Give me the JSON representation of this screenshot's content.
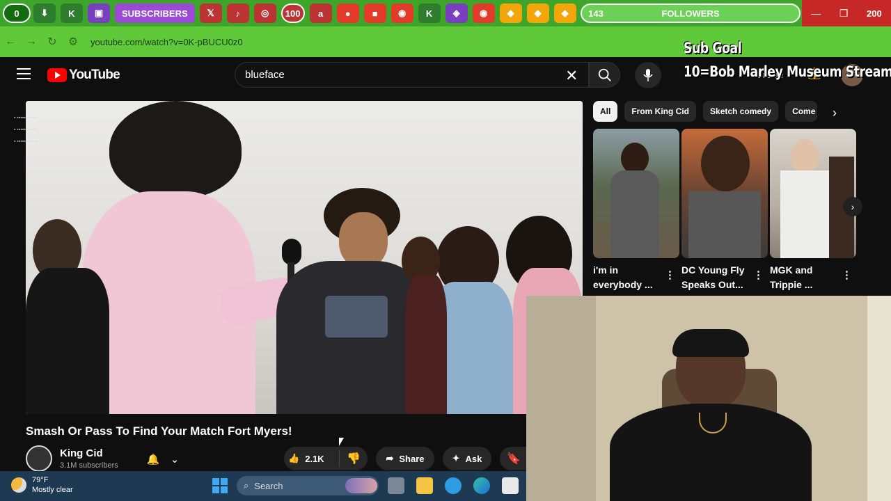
{
  "stream_bar": {
    "left_count": "0",
    "subscribers_label": "SUBSCRIBERS",
    "badge_100": "100",
    "followers_count": "143",
    "followers_label": "FOLLOWERS",
    "right_count": "200"
  },
  "browser": {
    "url": "youtube.com/watch?v=0K-pBUCU0z0"
  },
  "stream_overlay": {
    "sub_goal": "Sub Goal",
    "goal_text": "10=Bob Marley Museum Stream"
  },
  "youtube": {
    "logo_text": "YouTube",
    "search_query": "blueface",
    "create_label": "Create",
    "video_title": "Smash Or Pass To Find Your Match Fort Myers!",
    "channel_name": "King Cid",
    "channel_subs": "3.1M subscribers",
    "likes": "2.1K",
    "share_label": "Share",
    "ask_label": "Ask",
    "chips": [
      "All",
      "From King Cid",
      "Sketch comedy",
      "Come"
    ],
    "shorts": [
      {
        "title_l1": "i'm in",
        "title_l2": "everybody ..."
      },
      {
        "title_l1": "DC Young Fly",
        "title_l2": "Speaks Out..."
      },
      {
        "title_l1": "MGK and",
        "title_l2": "Trippie ..."
      }
    ]
  },
  "taskbar": {
    "temp": "79°F",
    "weather": "Mostly clear",
    "search_label": "Search"
  },
  "colors": {
    "stream_green": "#3da62a",
    "youtube_red": "#ff0000",
    "subscriber_purple": "#9b4ad6"
  }
}
